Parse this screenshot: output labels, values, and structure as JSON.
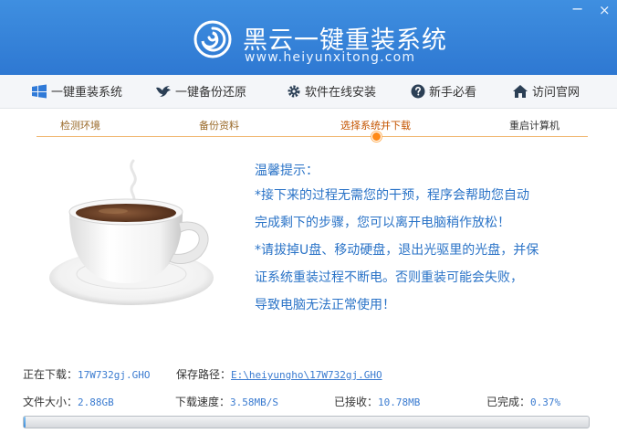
{
  "window": {
    "minimize_glyph": "−",
    "close_glyph": "×"
  },
  "brand": {
    "title": "黑云一键重装系统",
    "url": "www.heiyunxitong.com"
  },
  "nav": {
    "items": [
      {
        "label": "一键重装系统",
        "icon": "windows-icon"
      },
      {
        "label": "一键备份还原",
        "icon": "bird-icon"
      },
      {
        "label": "软件在线安装",
        "icon": "gear-icon"
      },
      {
        "label": "新手必看",
        "icon": "help-icon"
      },
      {
        "label": "访问官网",
        "icon": "home-icon"
      }
    ]
  },
  "steps": {
    "items": [
      {
        "label": "检测环境"
      },
      {
        "label": "备份资料"
      },
      {
        "label": "选择系统并下载"
      },
      {
        "label": "重启计算机"
      }
    ],
    "active_index": 2
  },
  "tips": {
    "title": "温馨提示：",
    "lines": [
      "*接下来的过程无需您的干预，程序会帮助您自动",
      " 完成剩下的步骤，您可以离开电脑稍作放松！",
      "*请拔掉U盘、移动硬盘，退出光驱里的光盘，并保",
      " 证系统重装过程不断电。否则重装可能会失败，",
      " 导致电脑无法正常使用！"
    ]
  },
  "download": {
    "downloading_label": "正在下载：",
    "downloading_value": "17W732gj.GHO",
    "path_label": "保存路径：",
    "path_value": "E:\\heiyungho\\17W732gj.GHO",
    "size_label": "文件大小：",
    "size_value": "2.88GB",
    "speed_label": "下载速度：",
    "speed_value": "3.58MB/S",
    "received_label": "已接收：",
    "received_value": "10.78MB",
    "done_label": "已完成：",
    "done_value": "0.37%",
    "progress_fraction": 0.0037
  },
  "colors": {
    "header": "#2e78d2",
    "tip_text": "#2a73c7",
    "step_active": "#ff8a18"
  }
}
